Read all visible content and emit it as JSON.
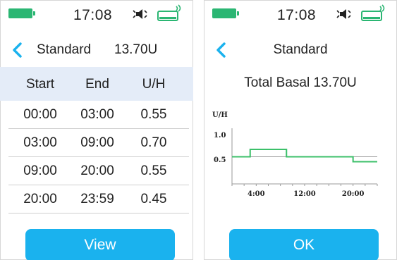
{
  "left_screen": {
    "status_bar": {
      "time": "17:08"
    },
    "header": {
      "title": "Standard",
      "total": "13.70U"
    },
    "table": {
      "headers": [
        "Start",
        "End",
        "U/H"
      ],
      "rows": [
        [
          "00:00",
          "03:00",
          "0.55"
        ],
        [
          "03:00",
          "09:00",
          "0.70"
        ],
        [
          "09:00",
          "20:00",
          "0.55"
        ],
        [
          "20:00",
          "23:59",
          "0.45"
        ]
      ]
    },
    "view_button": "View"
  },
  "right_screen": {
    "status_bar": {
      "time": "17:08"
    },
    "header": {
      "title": "Standard"
    },
    "total_basal": "Total Basal 13.70U",
    "ok_button": "OK"
  },
  "icons": {
    "battery": "battery-full-icon",
    "mute": "speaker-muted-icon",
    "pump": "pump-connected-icon",
    "back": "chevron-left-icon"
  },
  "colors": {
    "accent": "#1ab2ee",
    "battery": "#2bb673",
    "header_row": "#e4ecf8",
    "chart_line": "#3cc06a"
  },
  "chart_data": {
    "type": "line",
    "step": true,
    "ylabel": "U/H",
    "y_ticks": [
      "1.0",
      "0.5"
    ],
    "x_ticks": [
      "4:00",
      "12:00",
      "20:00"
    ],
    "x_tick_values": [
      4,
      12,
      20
    ],
    "xlim": [
      0,
      24
    ],
    "ylim": [
      0,
      1.5
    ],
    "series": [
      {
        "x": [
          0,
          3,
          9,
          20,
          24
        ],
        "values": [
          0.55,
          0.7,
          0.55,
          0.45,
          0.45
        ]
      }
    ]
  }
}
